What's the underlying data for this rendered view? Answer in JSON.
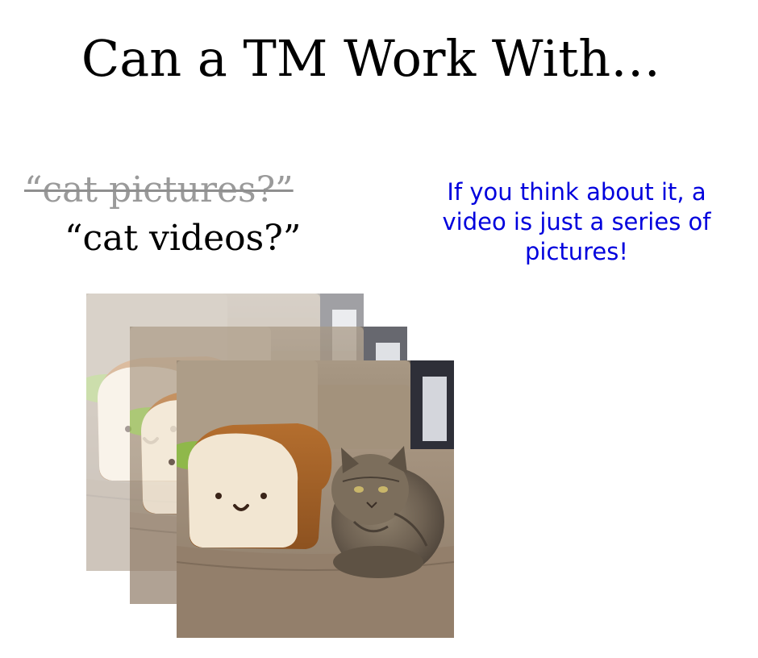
{
  "slide": {
    "title": "Can a TM Work With…",
    "struck_text": "“cat pictures?”",
    "replacement_text": "“cat videos?”",
    "note": "If you think about it, a video is just a series of pictures!"
  },
  "colors": {
    "note": "#0000dd",
    "struck": "#9a9a9a",
    "title": "#000000"
  },
  "frames": [
    {
      "name": "frame-1",
      "description_icon": "cat-bread-photo-icon"
    },
    {
      "name": "frame-2",
      "description_icon": "cat-bread-photo-icon"
    },
    {
      "name": "frame-3",
      "description_icon": "cat-bread-photo-icon"
    }
  ]
}
